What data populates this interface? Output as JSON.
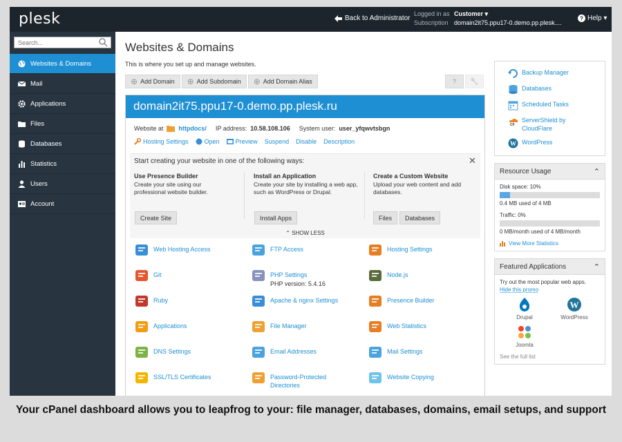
{
  "topbar": {
    "logo": "plesk",
    "back": "Back to Administrator",
    "logged_in_label": "Logged in as",
    "user": "Customer ▾",
    "subscription_label": "Subscription",
    "subscription": "domain2it75.ppu17-0.demo.pp.plesk....",
    "help": "Help ▾"
  },
  "sidebar": {
    "search_placeholder": "Search...",
    "items": [
      {
        "label": "Websites & Domains",
        "icon": "globe-icon"
      },
      {
        "label": "Mail",
        "icon": "mail-icon"
      },
      {
        "label": "Applications",
        "icon": "gear-icon"
      },
      {
        "label": "Files",
        "icon": "folder-icon"
      },
      {
        "label": "Databases",
        "icon": "database-icon"
      },
      {
        "label": "Statistics",
        "icon": "bar-chart-icon"
      },
      {
        "label": "Users",
        "icon": "user-icon"
      },
      {
        "label": "Account",
        "icon": "account-icon"
      }
    ]
  },
  "main": {
    "title": "Websites & Domains",
    "description": "This is where you set up and manage websites.",
    "toolbar": {
      "add_domain": "Add Domain",
      "add_subdomain": "Add Subdomain",
      "add_alias": "Add Domain Alias",
      "help": "?",
      "tools": "🔧"
    }
  },
  "domain": {
    "name": "domain2it75.ppu17-0.demo.pp.plesk.ru",
    "website_at": "Website at",
    "folder": "httpdocs/",
    "ip_label": "IP address:",
    "ip": "10.58.108.106",
    "user_label": "System user:",
    "user": "user_yfqwvtsbgn",
    "links": [
      "Hosting Settings",
      "Open",
      "Preview",
      "Suspend",
      "Disable",
      "Description"
    ]
  },
  "start": {
    "title": "Start creating your website in one of the following ways:",
    "close": "✕",
    "options": [
      {
        "heading": "Use Presence Builder",
        "desc": "Create your site using our professional website builder.",
        "buttons": [
          "Create Site"
        ]
      },
      {
        "heading": "Install an Application",
        "desc": "Create your site by installing a web app, such as WordPress or Drupal.",
        "buttons": [
          "Install Apps"
        ]
      },
      {
        "heading": "Create a Custom Website",
        "desc": "Upload your web content and add databases.",
        "buttons": [
          "Files",
          "Databases"
        ]
      }
    ],
    "show_less": "⌃ SHOW LESS"
  },
  "tools": [
    {
      "label": "Web Hosting Access",
      "icon": "web-hosting-access-icon",
      "color": "#3a8ed6"
    },
    {
      "label": "FTP Access",
      "icon": "ftp-access-icon",
      "color": "#4aa3df"
    },
    {
      "label": "Hosting Settings",
      "icon": "hosting-settings-icon",
      "color": "#e67e22"
    },
    {
      "label": "Git",
      "icon": "git-icon",
      "color": "#e4572e"
    },
    {
      "label": "PHP Settings",
      "sub": "PHP version: 5.4.16",
      "icon": "php-icon",
      "color": "#8892be"
    },
    {
      "label": "Node.js",
      "icon": "nodejs-icon",
      "color": "#5a6b3a"
    },
    {
      "label": "Ruby",
      "icon": "ruby-icon",
      "color": "#c0392b"
    },
    {
      "label": "Apache & nginx Settings",
      "icon": "apache-nginx-icon",
      "color": "#3a8ed6"
    },
    {
      "label": "Presence Builder",
      "icon": "presence-builder-icon",
      "color": "#e67e22"
    },
    {
      "label": "Applications",
      "icon": "applications-icon",
      "color": "#f39c12"
    },
    {
      "label": "File Manager",
      "icon": "file-manager-icon",
      "color": "#f0a030"
    },
    {
      "label": "Web Statistics",
      "icon": "web-statistics-icon",
      "color": "#e67e22"
    },
    {
      "label": "DNS Settings",
      "icon": "dns-settings-icon",
      "color": "#7cb342"
    },
    {
      "label": "Email Addresses",
      "icon": "email-addresses-icon",
      "color": "#4aa3df"
    },
    {
      "label": "Mail Settings",
      "icon": "mail-settings-icon",
      "color": "#4aa3df"
    },
    {
      "label": "SSL/TLS Certificates",
      "icon": "ssl-certificates-icon",
      "color": "#f5b400"
    },
    {
      "label": "Password-Protected Directories",
      "icon": "password-directories-icon",
      "color": "#f0a030"
    },
    {
      "label": "Website Copying",
      "icon": "website-copying-icon",
      "color": "#6fc3e8"
    }
  ],
  "shortcuts": [
    {
      "label": "Backup Manager",
      "icon": "backup-icon"
    },
    {
      "label": "Databases",
      "icon": "databases-icon"
    },
    {
      "label": "Scheduled Tasks",
      "icon": "calendar-icon"
    },
    {
      "label": "ServerShield by CloudFlare",
      "icon": "cloudflare-icon"
    },
    {
      "label": "WordPress",
      "icon": "wordpress-icon"
    }
  ],
  "resource": {
    "title": "Resource Usage",
    "disk_label": "Disk space: 10%",
    "disk_fraction": 0.1,
    "disk_detail": "0.4 MB used of 4 MB",
    "traffic_label": "Traffic: 0%",
    "traffic_fraction": 0,
    "traffic_detail": "0 MB/month used of 4 MB/month",
    "more": "View More Statistics"
  },
  "featured": {
    "title": "Featured Applications",
    "intro": "Try out the most popular web apps.",
    "hide": "Hide this promo",
    "apps": [
      "Drupal",
      "WordPress",
      "Joomla"
    ],
    "see_all": "See the full list"
  },
  "caption": "Your cPanel dashboard allows you to leapfrog to your: file manager, databases, domains, email setups, and support",
  "colors": {
    "accent": "#1e8fd3",
    "topbar": "#1d252c",
    "sidebar": "#283540"
  }
}
